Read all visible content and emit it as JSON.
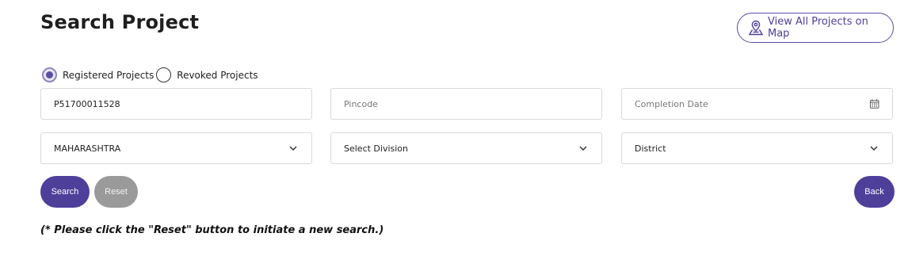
{
  "page": {
    "title": "Search Project"
  },
  "header": {
    "map_button_label": "View All Projects on Map",
    "map_icon": "map-pin-icon"
  },
  "filters": {
    "project_type": [
      {
        "label": "Registered Projects",
        "selected": true
      },
      {
        "label": "Revoked Projects",
        "selected": false
      }
    ]
  },
  "form": {
    "registration_number": {
      "value": "P51700011528",
      "placeholder": ""
    },
    "pincode": {
      "value": "",
      "placeholder": "Pincode"
    },
    "completion_date": {
      "value": "",
      "placeholder": "Completion Date",
      "icon": "calendar-icon"
    },
    "state": {
      "selected": "MAHARASHTRA"
    },
    "division": {
      "selected": "Select Division"
    },
    "district": {
      "selected": "District"
    }
  },
  "actions": {
    "search_label": "Search",
    "reset_label": "Reset",
    "back_label": "Back"
  },
  "note": "(* Please click the \"Reset\" button to initiate a new search.)",
  "colors": {
    "primary": "#4d3f9a",
    "reset": "#9a9a9a",
    "border": "#d9d9d9"
  }
}
